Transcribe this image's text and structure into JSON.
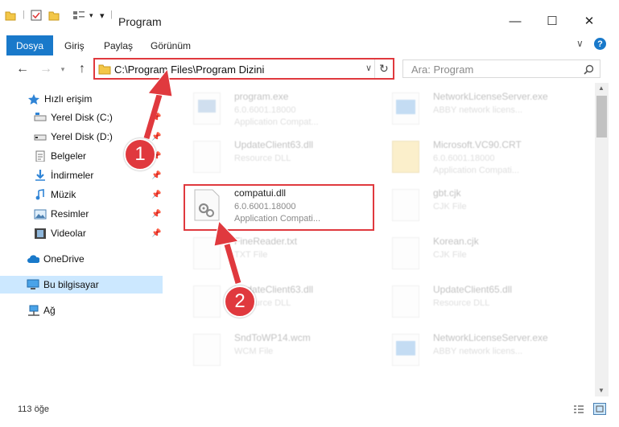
{
  "window": {
    "title": "Program",
    "minimize_icon": "—",
    "maximize_icon": "☐",
    "close_icon": "✕"
  },
  "ribbon": {
    "file_tab": "Dosya",
    "tabs": [
      "Giriş",
      "Paylaş",
      "Görünüm"
    ],
    "expand_icon": "∨",
    "help_icon": "?"
  },
  "address": {
    "path": "C:\\Program Files\\Program Dizini",
    "search_placeholder": "Ara: Program"
  },
  "sidebar": {
    "items": [
      {
        "label": "Hızlı erişim",
        "icon": "star-icon"
      },
      {
        "label": "Yerel Disk (C:)",
        "icon": "drive-icon",
        "pinned": true
      },
      {
        "label": "Yerel Disk (D:)",
        "icon": "drive-icon",
        "pinned": true
      },
      {
        "label": "Belgeler",
        "icon": "documents-icon",
        "pinned": true
      },
      {
        "label": "İndirmeler",
        "icon": "download-icon",
        "pinned": true
      },
      {
        "label": "Müzik",
        "icon": "music-icon",
        "pinned": true
      },
      {
        "label": "Resimler",
        "icon": "pictures-icon",
        "pinned": true
      },
      {
        "label": "Videolar",
        "icon": "videos-icon",
        "pinned": true
      },
      {
        "label": "OneDrive",
        "icon": "cloud-icon"
      },
      {
        "label": "Bu bilgisayar",
        "icon": "computer-icon",
        "selected": true
      },
      {
        "label": "Ağ",
        "icon": "network-icon"
      }
    ]
  },
  "files": [
    {
      "name": "program.exe",
      "desc": "6.0.6001.18000",
      "type": "Application Compat..."
    },
    {
      "name": "NetworkLicenseServer.exe",
      "desc": "ABBY network licens...",
      "type": ""
    },
    {
      "name": "UpdateClient63.dll",
      "desc": "Resource DLL",
      "type": ""
    },
    {
      "name": "Microsoft.VC90.CRT",
      "desc": "6.0.6001.18000",
      "type": "Application Compati..."
    },
    {
      "name": "compatui.dll",
      "desc": "6.0.6001.18000",
      "type": "Application Compati..."
    },
    {
      "name": "gbt.cjk",
      "desc": "CJK File",
      "type": ""
    },
    {
      "name": "FineReader.txt",
      "desc": "TXT File",
      "type": ""
    },
    {
      "name": "Korean.cjk",
      "desc": "CJK File",
      "type": ""
    },
    {
      "name": "UpdateClient63.dll",
      "desc": "Resource DLL",
      "type": ""
    },
    {
      "name": "UpdateClient65.dll",
      "desc": "Resource DLL",
      "type": ""
    },
    {
      "name": "SndToWP14.wcm",
      "desc": "WCM File",
      "type": ""
    },
    {
      "name": "NetworkLicenseServer.exe",
      "desc": "ABBY network licens...",
      "type": ""
    }
  ],
  "status": {
    "count": "113 öğe"
  },
  "annotations": {
    "step1": "1",
    "step2": "2",
    "color": "#e0393e"
  }
}
